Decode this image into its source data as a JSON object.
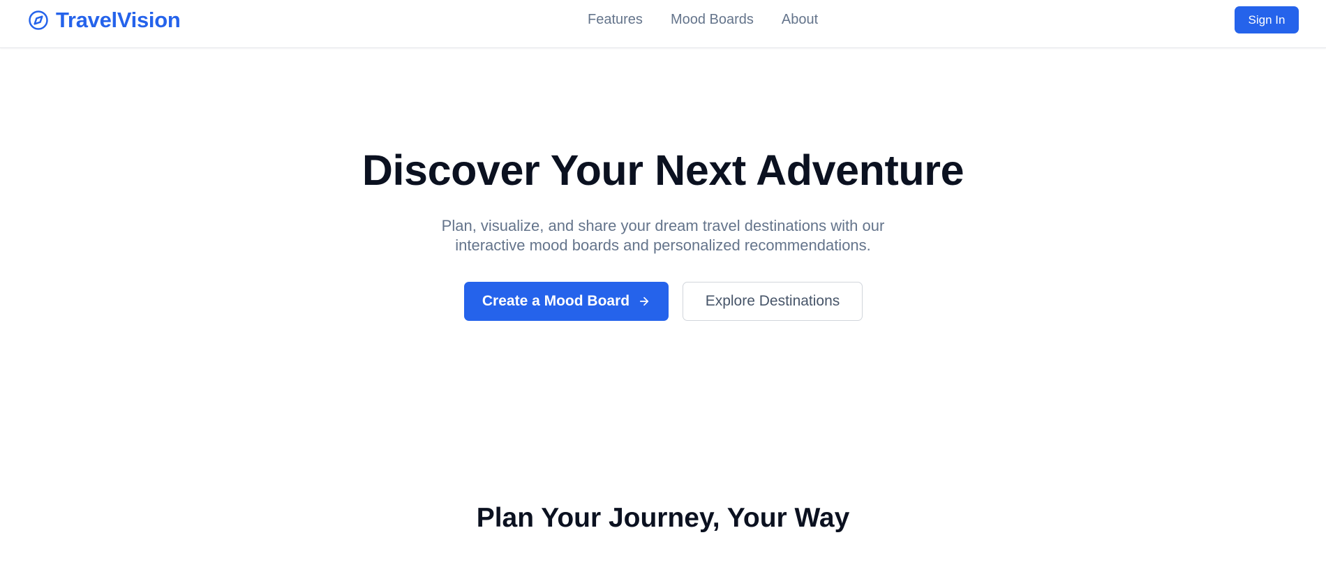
{
  "header": {
    "brand": {
      "name": "TravelVision",
      "icon": "compass-icon",
      "color": "#2563eb"
    },
    "nav": [
      {
        "label": "Features"
      },
      {
        "label": "Mood Boards"
      },
      {
        "label": "About"
      }
    ],
    "sign_in_label": "Sign In"
  },
  "hero": {
    "title": "Discover Your Next Adventure",
    "subtitle_lines": [
      "Plan, visualize, and share your dream travel destinations with our",
      "interactive mood boards and personalized recommendations."
    ],
    "primary_cta": {
      "label": "Create a Mood Board",
      "icon": "arrow-right-icon"
    },
    "secondary_cta": {
      "label": "Explore Destinations"
    }
  },
  "features_section": {
    "title": "Plan Your Journey, Your Way"
  },
  "colors": {
    "accent": "#2563eb",
    "heading": "#0b1120",
    "muted_text": "#64748b",
    "border": "#e5e7eb"
  }
}
